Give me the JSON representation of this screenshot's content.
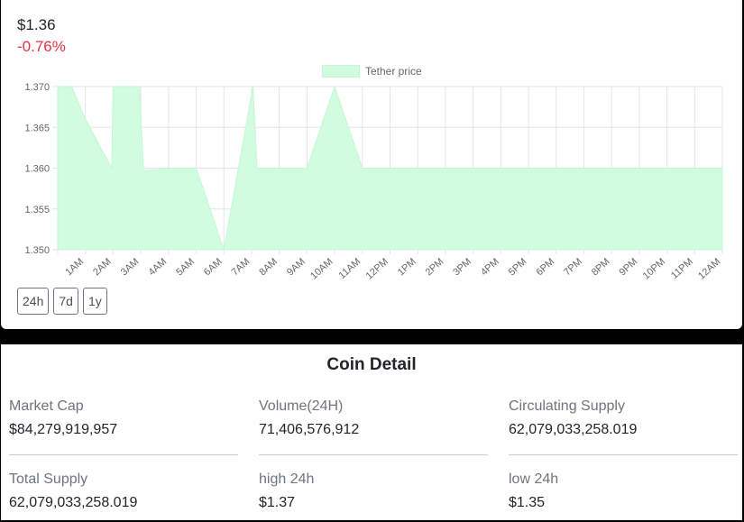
{
  "header": {
    "price": "$1.36",
    "change": "-0.76%"
  },
  "range_buttons": [
    "24h",
    "7d",
    "1y"
  ],
  "detail": {
    "title": "Coin Detail",
    "stats": [
      {
        "label": "Market Cap",
        "value": "$84,279,919,957"
      },
      {
        "label": "Volume(24H)",
        "value": "71,406,576,912"
      },
      {
        "label": "Circulating Supply",
        "value": "62,079,033,258.019"
      },
      {
        "label": "Total Supply",
        "value": "62,079,033,258.019"
      },
      {
        "label": "high 24h",
        "value": "$1.37"
      },
      {
        "label": "low 24h",
        "value": "$1.35"
      }
    ]
  },
  "colors": {
    "fill": "#d1fcdf",
    "negative": "#dc3545",
    "grid": "#e5e5e5"
  },
  "chart_data": {
    "type": "area",
    "title": "",
    "xlabel": "",
    "ylabel": "",
    "legend": "top-center",
    "grid": true,
    "series": [
      {
        "name": "Tether price",
        "points": [
          [
            0.0,
            1.37
          ],
          [
            0.5,
            1.37
          ],
          [
            1.0,
            1.366
          ],
          [
            1.95,
            1.36
          ],
          [
            2.0,
            1.37
          ],
          [
            2.95,
            1.37
          ],
          [
            3.1,
            1.3597
          ],
          [
            3.5,
            1.3598
          ],
          [
            4.0,
            1.36
          ],
          [
            5.0,
            1.36
          ],
          [
            6.0,
            1.35
          ],
          [
            7.05,
            1.37
          ],
          [
            7.2,
            1.36
          ],
          [
            8.0,
            1.36
          ],
          [
            9.0,
            1.36
          ],
          [
            10.0,
            1.37
          ],
          [
            11.0,
            1.36
          ],
          [
            12.0,
            1.36
          ],
          [
            13.0,
            1.36
          ],
          [
            14.0,
            1.36
          ],
          [
            15.0,
            1.36
          ],
          [
            16.0,
            1.36
          ],
          [
            17.0,
            1.36
          ],
          [
            18.0,
            1.36
          ],
          [
            19.0,
            1.36
          ],
          [
            20.0,
            1.36
          ],
          [
            21.0,
            1.36
          ],
          [
            22.0,
            1.36
          ],
          [
            23.0,
            1.36
          ],
          [
            24.0,
            1.36
          ]
        ]
      }
    ],
    "x_tick_labels": [
      "1AM",
      "2AM",
      "3AM",
      "4AM",
      "5AM",
      "6AM",
      "7AM",
      "8AM",
      "9AM",
      "10AM",
      "11AM",
      "12PM",
      "1PM",
      "2PM",
      "3PM",
      "4PM",
      "5PM",
      "6PM",
      "7PM",
      "8PM",
      "9PM",
      "10PM",
      "11PM",
      "12AM"
    ],
    "y_ticks": [
      "1.370",
      "1.365",
      "1.360",
      "1.355",
      "1.350"
    ],
    "ylim": [
      1.35,
      1.37
    ]
  }
}
